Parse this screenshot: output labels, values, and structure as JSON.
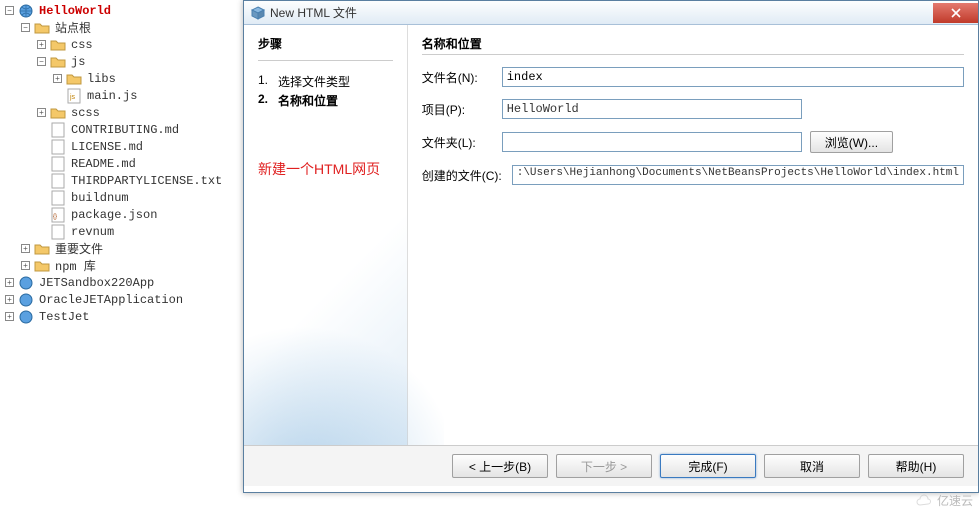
{
  "tree": {
    "project": "HelloWorld",
    "siteRoot": "站点根",
    "css": "css",
    "js": "js",
    "libs": "libs",
    "mainjs": "main.js",
    "scss": "scss",
    "contributing": "CONTRIBUTING.md",
    "license": "LICENSE.md",
    "readme": "README.md",
    "thirdparty": "THIRDPARTYLICENSE.txt",
    "buildnum": "buildnum",
    "packagejson": "package.json",
    "revnum": "revnum",
    "important": "重要文件",
    "npm": "npm 库",
    "jetsandbox": "JETSandbox220App",
    "oraclejet": "OracleJETApplication",
    "testjet": "TestJet"
  },
  "dialog": {
    "title": "New HTML 文件",
    "steps": {
      "header": "步骤",
      "s1_num": "1.",
      "s1_label": "选择文件类型",
      "s2_num": "2.",
      "s2_label": "名称和位置"
    },
    "annotation": "新建一个HTML网页",
    "form": {
      "header": "名称和位置",
      "filename_label": "文件名(N):",
      "filename_value": "index",
      "project_label": "项目(P):",
      "project_value": "HelloWorld",
      "folder_label": "文件夹(L):",
      "folder_value": "",
      "browse_label": "浏览(W)...",
      "created_label": "创建的文件(C):",
      "created_value": ":\\Users\\Hejianhong\\Documents\\NetBeansProjects\\HelloWorld\\index.html"
    },
    "buttons": {
      "back": "< 上一步(B)",
      "next": "下一步 >",
      "finish": "完成(F)",
      "cancel": "取消",
      "help": "帮助(H)"
    }
  },
  "watermark": "亿速云"
}
